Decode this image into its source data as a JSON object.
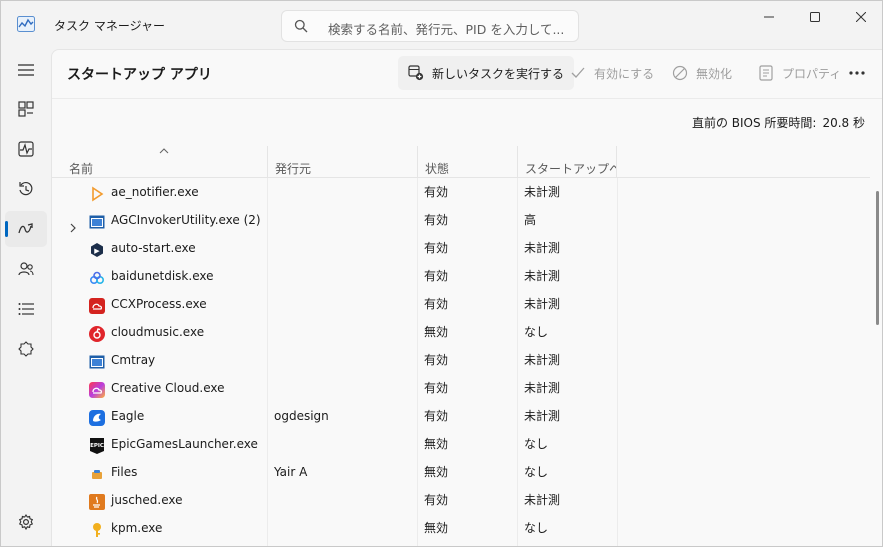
{
  "window": {
    "title": "タスク マネージャー",
    "search_placeholder": "検索する名前、発行元、PID を入力して...",
    "minimize": "—",
    "maximize": "☐",
    "close": "✕"
  },
  "nav": {
    "items": [
      {
        "icon": "hamburger-menu-icon"
      },
      {
        "icon": "processes-icon"
      },
      {
        "icon": "performance-icon"
      },
      {
        "icon": "app-history-icon"
      },
      {
        "icon": "startup-apps-icon",
        "active": true
      },
      {
        "icon": "users-icon"
      },
      {
        "icon": "details-icon"
      },
      {
        "icon": "services-icon"
      },
      {
        "icon": "settings-icon"
      }
    ]
  },
  "page": {
    "title": "スタートアップ アプリ",
    "toolbar": {
      "new_task": "新しいタスクを実行する",
      "enable": "有効にする",
      "disable": "無効化",
      "properties": "プロパティ",
      "more": "•••"
    },
    "bios_label": "直前の BIOS 所要時間:",
    "bios_value": "20.8 秒"
  },
  "table": {
    "headers": {
      "name": "名前",
      "publisher": "発行元",
      "status": "状態",
      "impact": "スタートアップへ..."
    },
    "rows": [
      {
        "name": "ae_notifier.exe",
        "publisher": "",
        "status": "有効",
        "impact": "未計測",
        "icon_color": "#f29b2e",
        "icon": "play-triangle-icon",
        "expandable": false
      },
      {
        "name": "AGCInvokerUtility.exe (2)",
        "publisher": "",
        "status": "有効",
        "impact": "高",
        "icon_color": "#1f5fa8",
        "icon": "window-icon",
        "expandable": true
      },
      {
        "name": "auto-start.exe",
        "publisher": "",
        "status": "有効",
        "impact": "未計測",
        "icon_color": "#1c2e4a",
        "icon": "hex-icon",
        "expandable": false
      },
      {
        "name": "baidunetdisk.exe",
        "publisher": "",
        "status": "有効",
        "impact": "未計測",
        "icon_color": "#3b8cf5",
        "icon": "cloud-icon",
        "expandable": false
      },
      {
        "name": "CCXProcess.exe",
        "publisher": "",
        "status": "有効",
        "impact": "未計測",
        "icon_color": "#d4231f",
        "icon": "creative-cloud-icon",
        "expandable": false
      },
      {
        "name": "cloudmusic.exe",
        "publisher": "",
        "status": "無効",
        "impact": "なし",
        "icon_color": "#e0252b",
        "icon": "music-icon",
        "expandable": false
      },
      {
        "name": "Cmtray",
        "publisher": "",
        "status": "有効",
        "impact": "未計測",
        "icon_color": "#1f5fa8",
        "icon": "window-icon",
        "expandable": false
      },
      {
        "name": "Creative Cloud.exe",
        "publisher": "",
        "status": "有効",
        "impact": "未計測",
        "icon_color": "#e8443a",
        "icon": "creative-cloud-gradient-icon",
        "expandable": false
      },
      {
        "name": "Eagle",
        "publisher": "ogdesign",
        "status": "有効",
        "impact": "未計測",
        "icon_color": "#1d6fe0",
        "icon": "eagle-icon",
        "expandable": false
      },
      {
        "name": "EpicGamesLauncher.exe",
        "publisher": "",
        "status": "無効",
        "impact": "なし",
        "icon_color": "#111111",
        "icon": "epic-icon",
        "expandable": false
      },
      {
        "name": "Files",
        "publisher": "Yair A",
        "status": "無効",
        "impact": "なし",
        "icon_color": "#e8a23a",
        "icon": "files-icon",
        "expandable": false
      },
      {
        "name": "jusched.exe",
        "publisher": "",
        "status": "有効",
        "impact": "未計測",
        "icon_color": "#e07a1e",
        "icon": "java-icon",
        "expandable": false
      },
      {
        "name": "kpm.exe",
        "publisher": "",
        "status": "無効",
        "impact": "なし",
        "icon_color": "#f2b01e",
        "icon": "key-icon",
        "expandable": false
      }
    ]
  }
}
